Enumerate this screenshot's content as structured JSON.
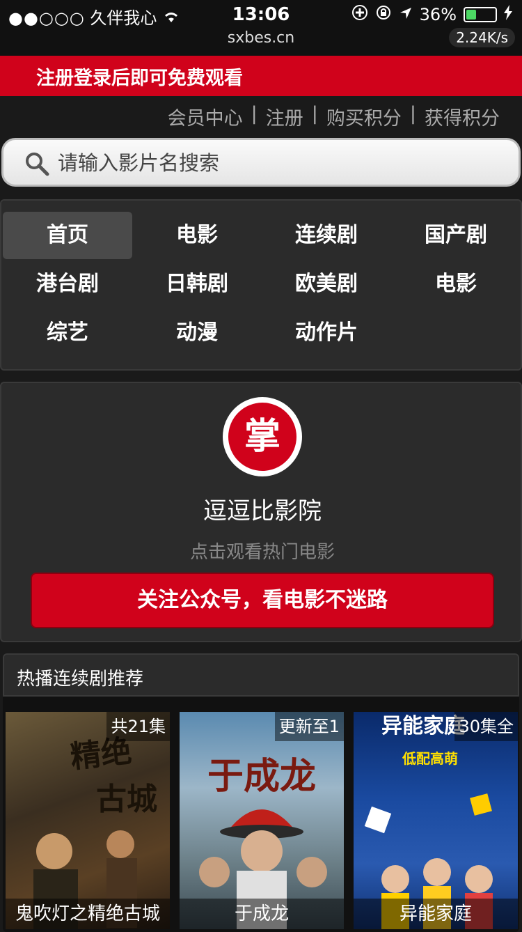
{
  "status_bar": {
    "carrier": "久伴我心",
    "time": "13:06",
    "battery": "36%",
    "battery_level": 0.36,
    "url": "sxbes.cn",
    "speed": "2.24K/s"
  },
  "banner": {
    "text": "注册登录后即可免费观看"
  },
  "top_links": {
    "member": "会员中心",
    "register": "注册",
    "buy": "购买积分",
    "earn": "获得积分",
    "sep": "|"
  },
  "search": {
    "placeholder": "请输入影片名搜索"
  },
  "nav": {
    "items": [
      {
        "label": "首页"
      },
      {
        "label": "电影"
      },
      {
        "label": "连续剧"
      },
      {
        "label": "国产剧"
      },
      {
        "label": "港台剧"
      },
      {
        "label": "日韩剧"
      },
      {
        "label": "欧美剧"
      },
      {
        "label": "电影"
      },
      {
        "label": "综艺"
      },
      {
        "label": "动漫"
      },
      {
        "label": "动作片"
      }
    ]
  },
  "promo": {
    "logo_char": "掌",
    "name": "逗逗比影院",
    "subtitle": "点击观看热门电影",
    "button": "关注公众号，看电影不迷路"
  },
  "section": {
    "title": "热播连续剧推荐",
    "cards": [
      {
        "title": "鬼吹灯之精绝古城",
        "badge": "共21集"
      },
      {
        "title": "于成龙",
        "badge": "更新至1"
      },
      {
        "title": "异能家庭",
        "badge": "30集全"
      }
    ]
  },
  "colors": {
    "accent": "#d0021b",
    "background": "#1a1a1a",
    "panel": "#2b2b2b"
  }
}
